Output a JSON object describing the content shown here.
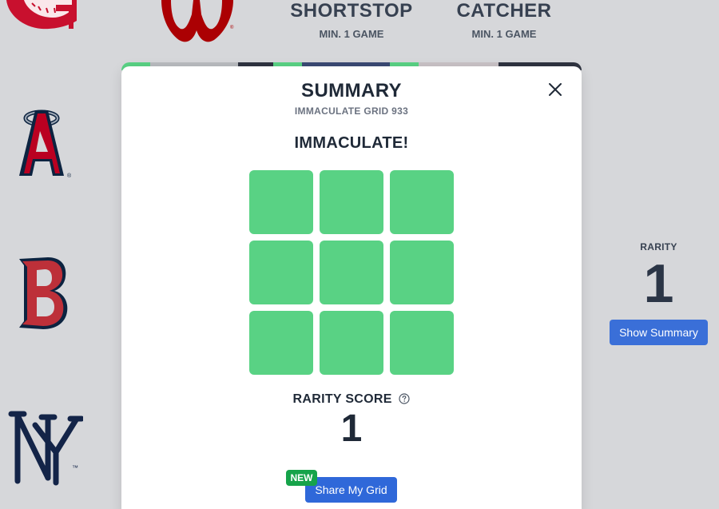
{
  "background": {
    "columns": [
      {
        "title": "SHORTSTOP",
        "subtitle": "MIN. 1 GAME"
      },
      {
        "title": "CATCHER",
        "subtitle": "MIN. 1 GAME"
      }
    ],
    "logos": [
      "reds-logo",
      "nationals-logo",
      "angels-logo",
      "red-sox-logo",
      "yankees-logo"
    ],
    "rarity": {
      "label": "RARITY",
      "value": "1"
    },
    "show_summary_label": "Show Summary"
  },
  "modal": {
    "title": "SUMMARY",
    "subtitle": "IMMACULATE GRID 933",
    "result": "IMMACULATE!",
    "grid": {
      "rows": 3,
      "cols": 3,
      "cells": [
        "correct",
        "correct",
        "correct",
        "correct",
        "correct",
        "correct",
        "correct",
        "correct",
        "correct"
      ]
    },
    "rarity_score_label": "RARITY SCORE",
    "rarity_score_value": "1",
    "new_badge": "NEW",
    "share_label": "Share My Grid"
  },
  "colors": {
    "page_bg": "#d6d7da",
    "correct_cell": "#59d284",
    "primary_button": "#2f68d9",
    "new_badge": "#16a34a",
    "team_red": "#c8102e",
    "team_navy": "#0c2340",
    "yankees_navy": "#132448"
  }
}
